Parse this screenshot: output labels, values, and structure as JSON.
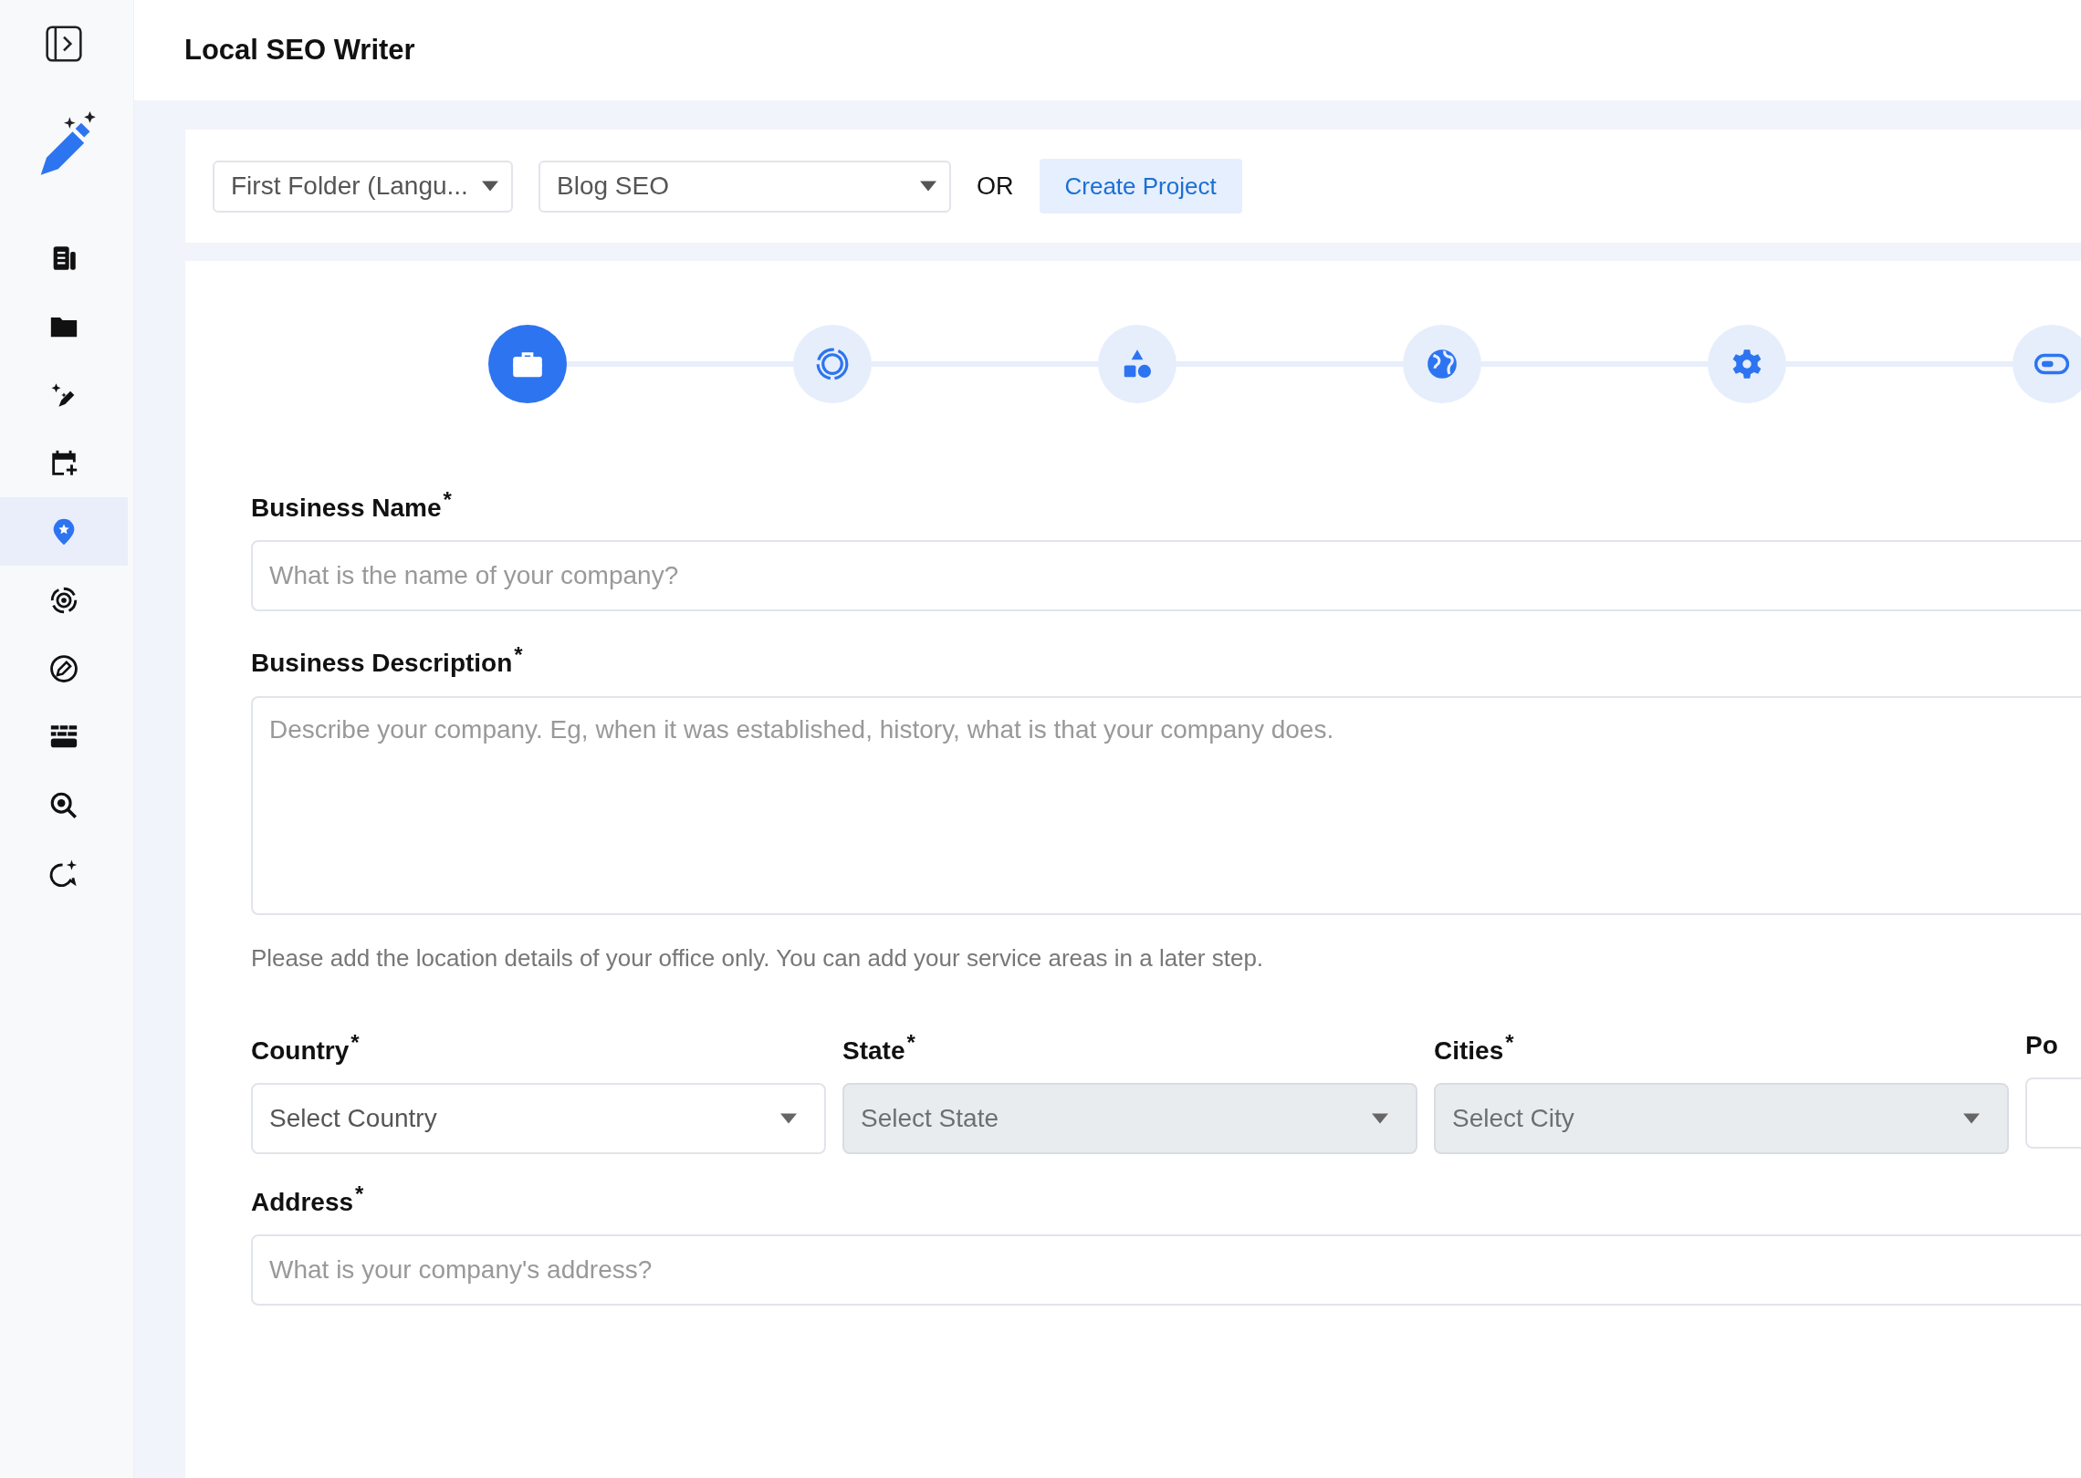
{
  "sidebar": {
    "items": [
      {
        "selected": false
      },
      {
        "selected": false
      },
      {
        "selected": false
      },
      {
        "selected": false
      },
      {
        "selected": true
      },
      {
        "selected": false
      },
      {
        "selected": false
      },
      {
        "selected": false
      },
      {
        "selected": false
      },
      {
        "selected": false
      }
    ]
  },
  "header": {
    "title": "Local SEO Writer"
  },
  "toolbar": {
    "folder": "First Folder (Langu...",
    "project": "Blog SEO",
    "separator": "OR",
    "button": "Create Project"
  },
  "steps": [
    {
      "selected": true
    },
    {
      "selected": false
    },
    {
      "selected": false
    },
    {
      "selected": false
    },
    {
      "selected": false
    },
    {
      "selected": false
    }
  ],
  "form": {
    "business_name": {
      "label": "Business Name",
      "required_mark": "*",
      "placeholder": "What is the name of your company?"
    },
    "business_description": {
      "label": "Business Description",
      "required_mark": "*",
      "placeholder": "Describe your company. Eg, when it was established, history, what is that your company does."
    },
    "note": "Please add the location details of your office only. You can add your service areas in a later step.",
    "location": [
      {
        "kind": "select",
        "label": "Country",
        "required_mark": "*",
        "value": "Select Country",
        "disabled": false
      },
      {
        "kind": "select",
        "label": "State",
        "required_mark": "*",
        "value": "Select State",
        "disabled": true
      },
      {
        "kind": "select",
        "label": "Cities",
        "required_mark": "*",
        "value": "Select City",
        "disabled": true
      },
      {
        "kind": "input",
        "label": "Po"
      }
    ],
    "address": {
      "label": "Address",
      "required_mark": "*",
      "placeholder": "What is your company's address?"
    }
  }
}
